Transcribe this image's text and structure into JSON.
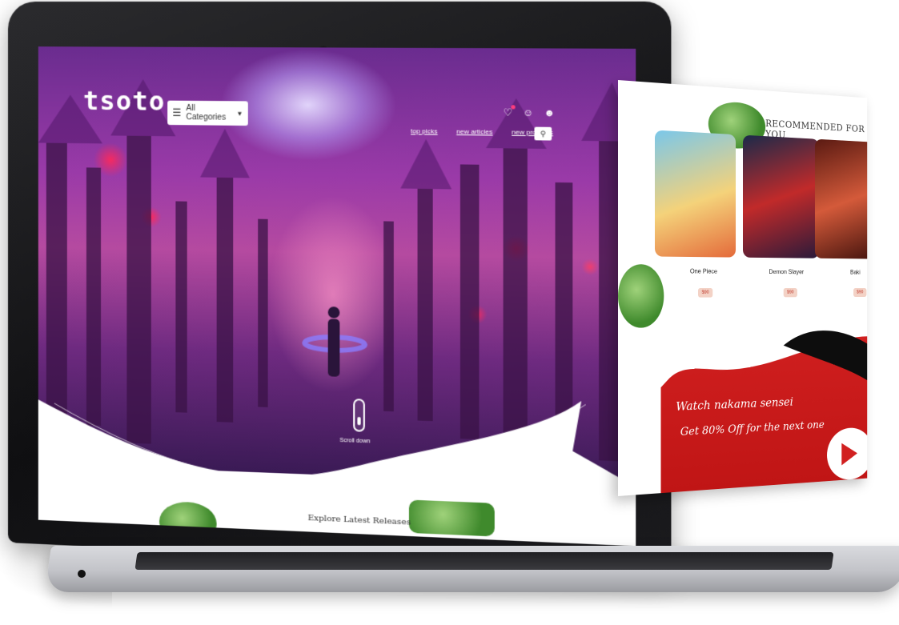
{
  "site": {
    "logo": "tsoto",
    "category_select": "All Categories",
    "nav_links": [
      "top picks",
      "new articles",
      "new products"
    ],
    "scroll_label": "Scroll down",
    "explore_title": "Explore Latest Releases"
  },
  "floating_page": {
    "section_title": "RECOMMENDED FOR YOU",
    "products": [
      {
        "title": "One Piece",
        "price": "$90"
      },
      {
        "title": "Demon Slayer",
        "price": "$90"
      },
      {
        "title": "Baki",
        "price": "$90"
      }
    ],
    "banner_line1": "Watch nakama sensei",
    "banner_line2": "Get 80% Off for the next one"
  },
  "icons": [
    "menu-icon",
    "chevron-down-icon",
    "heart-icon",
    "user-icon",
    "cart-icon",
    "search-icon",
    "play-icon"
  ],
  "colors": {
    "banner": "#d12020",
    "hero_purple": "#9a3aa8",
    "badge": "#ff3d7f"
  }
}
